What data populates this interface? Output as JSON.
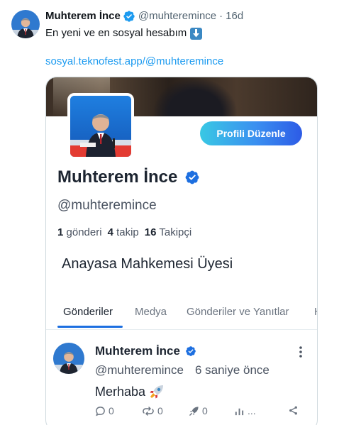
{
  "tweet": {
    "author_name": "Muhterem İnce",
    "handle": "@muhteremince",
    "separator": "·",
    "time": "16d",
    "text": "En yeni ve en sosyal hesabım",
    "emoji_icon": "down-arrow-emoji-icon",
    "link": "sosyal.teknofest.app/@muhteremince",
    "colors": {
      "link": "#1d9bf0",
      "verified": "#1d9bf0",
      "muted": "#536471"
    }
  },
  "embedded_profile": {
    "edit_button_label": "Profili Düzenle",
    "name": "Muhterem İnce",
    "handle": "@muhteremince",
    "stats": {
      "posts_count": "1",
      "posts_label": "gönderi",
      "following_count": "4",
      "following_label": "takip",
      "followers_count": "16",
      "followers_label": "Takipçi"
    },
    "bio": "Anayasa Mahkemesi Üyesi",
    "tabs": [
      {
        "label": "Gönderiler",
        "active": true
      },
      {
        "label": "Medya",
        "active": false
      },
      {
        "label": "Gönderiler ve Yanıtlar",
        "active": false
      },
      {
        "label": "H",
        "active": false
      }
    ],
    "post": {
      "author_name": "Muhterem İnce",
      "handle": "@muhteremince",
      "time": "6 saniye önce",
      "text": "Merhaba",
      "emoji_icon": "rocket-emoji-icon",
      "actions": {
        "reply_count": "0",
        "repost_count": "0",
        "boost_count": "0",
        "views_label": "..."
      }
    },
    "colors": {
      "accent": "#1d6fe0",
      "button_gradient_start": "#39c8e4",
      "button_gradient_end": "#2d5be6"
    }
  }
}
